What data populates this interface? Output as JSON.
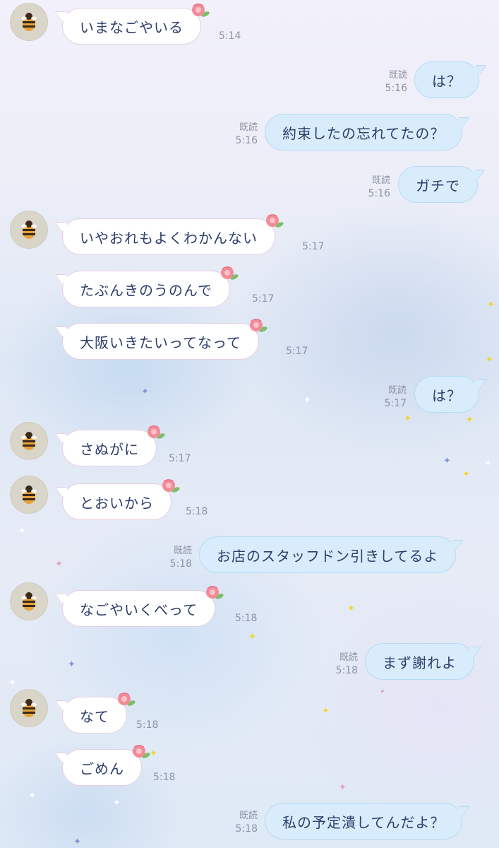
{
  "read_label": "既読",
  "messages": [
    {
      "side": "in",
      "text": "いまなごやいる",
      "time": "5:14",
      "avatar": true
    },
    {
      "side": "out",
      "text": "は？",
      "time": "5:16"
    },
    {
      "side": "out",
      "text": "約束したの忘れてたの？",
      "time": "5:16"
    },
    {
      "side": "out",
      "text": "ガチで",
      "time": "5:16"
    },
    {
      "side": "in",
      "text": "いやおれもよくわかんない",
      "time": "5:17",
      "avatar": true
    },
    {
      "side": "in",
      "text": "たぶんきのうのんで",
      "time": "5:17"
    },
    {
      "side": "in",
      "text": "大阪いきたいってなって",
      "time": "5:17"
    },
    {
      "side": "out",
      "text": "は？",
      "time": "5:17"
    },
    {
      "side": "in",
      "text": "さぬがに",
      "time": "5:17",
      "avatar": true
    },
    {
      "side": "in",
      "text": "とおいから",
      "time": "5:18",
      "avatar": true
    },
    {
      "side": "out",
      "text": "お店のスタッフドン引きしてるよ",
      "time": "5:18"
    },
    {
      "side": "in",
      "text": "なごやいくべって",
      "time": "5:18",
      "avatar": true
    },
    {
      "side": "out",
      "text": "まず謝れよ",
      "time": "5:18"
    },
    {
      "side": "in",
      "text": "なて",
      "time": "5:18",
      "avatar": true
    },
    {
      "side": "in",
      "text": "ごめん",
      "time": "5:18"
    },
    {
      "side": "out",
      "text": "私の予定潰してんだよ？",
      "time": "5:18"
    }
  ]
}
